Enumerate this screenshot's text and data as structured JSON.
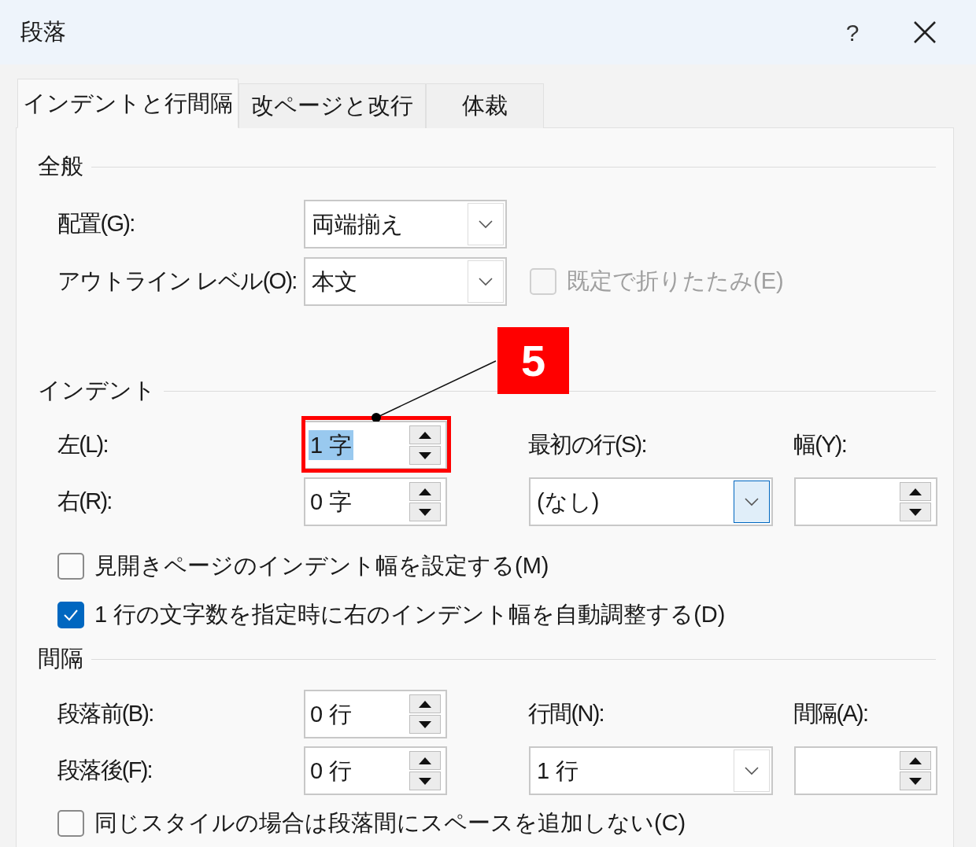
{
  "window": {
    "title": "段落",
    "help_button": "?"
  },
  "tabs": [
    {
      "label": "インデントと行間隔",
      "selected": true
    },
    {
      "label": "改ページと改行",
      "selected": false
    },
    {
      "label": "体裁",
      "selected": false
    }
  ],
  "general": {
    "title": "全般",
    "alignment": {
      "label": "配置(G):",
      "value": "両端揃え",
      "focused": false
    },
    "outline_level": {
      "label": "アウトライン レベル(O):",
      "value": "本文",
      "focused": false
    },
    "collapsed_by_default": {
      "label": "既定で折りたたみ(E)",
      "checked": false,
      "disabled": true
    }
  },
  "indent": {
    "title": "インデント",
    "left": {
      "label": "左(L):",
      "value": "1 字",
      "selected": true
    },
    "right": {
      "label": "右(R):",
      "value": "0 字",
      "selected": false
    },
    "first_line": {
      "label": "最初の行(S):",
      "value": "(なし)",
      "focused": true
    },
    "by": {
      "label": "幅(Y):"
    },
    "checkboxes": [
      {
        "label": "見開きページのインデント幅を設定する(M)",
        "checked": false,
        "disabled": false
      },
      {
        "label": "1 行の文字数を指定時に右のインデント幅を自動調整する(D)",
        "checked": true,
        "disabled": false
      }
    ]
  },
  "spacing": {
    "title": "間隔",
    "before": {
      "label": "段落前(B):",
      "value": "0 行",
      "selected": false
    },
    "after": {
      "label": "段落後(F):",
      "value": "0 行",
      "selected": false
    },
    "line_spacing": {
      "label": "行間(N):",
      "value": "1 行",
      "focused": false
    },
    "at": {
      "label": "間隔(A):"
    },
    "checkboxes": [
      {
        "label": "同じスタイルの場合は段落間にスペースを追加しない(C)",
        "checked": false,
        "disabled": false
      }
    ]
  },
  "callout": {
    "number": "5"
  }
}
